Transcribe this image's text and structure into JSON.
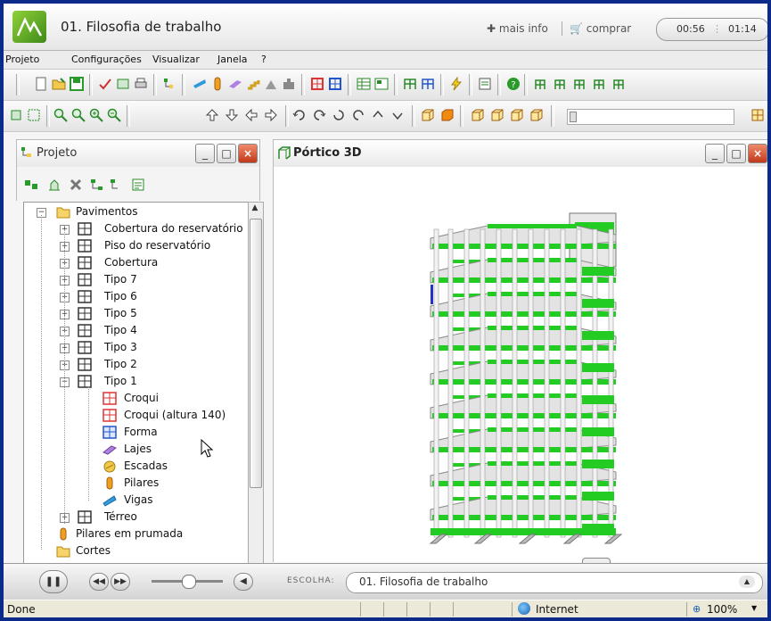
{
  "window": {
    "title": "01. Filosofia de trabalho",
    "mais_info": "mais info",
    "comprar": "comprar",
    "timer_elapsed": "00:56",
    "timer_total": "01:14"
  },
  "menu": [
    "Projeto",
    "Configurações",
    "Visualizar",
    "Janela",
    "?"
  ],
  "left_panel": {
    "title": "Projeto",
    "tree": [
      {
        "label": "Pavimentos",
        "icon": "folder-icon"
      },
      {
        "label": "Cobertura do reservatório",
        "icon": "floor-icon"
      },
      {
        "label": "Piso do reservatório",
        "icon": "floor-icon"
      },
      {
        "label": "Cobertura",
        "icon": "floor-icon"
      },
      {
        "label": "Tipo 7",
        "icon": "floor-icon"
      },
      {
        "label": "Tipo 6",
        "icon": "floor-icon"
      },
      {
        "label": "Tipo 5",
        "icon": "floor-icon"
      },
      {
        "label": "Tipo 4",
        "icon": "floor-icon"
      },
      {
        "label": "Tipo 3",
        "icon": "floor-icon"
      },
      {
        "label": "Tipo 2",
        "icon": "floor-icon"
      },
      {
        "label": "Tipo 1",
        "icon": "floor-icon"
      },
      {
        "label": "Croqui",
        "icon": "croqui-icon"
      },
      {
        "label": "Croqui (altura 140)",
        "icon": "croqui-icon"
      },
      {
        "label": "Forma",
        "icon": "forma-icon"
      },
      {
        "label": "Lajes",
        "icon": "slab-icon"
      },
      {
        "label": "Escadas",
        "icon": "stairs-icon"
      },
      {
        "label": "Pilares",
        "icon": "pillar-icon"
      },
      {
        "label": "Vigas",
        "icon": "beam-icon"
      },
      {
        "label": "Térreo",
        "icon": "floor-icon"
      },
      {
        "label": "Pilares em prumada",
        "icon": "pillar-icon"
      },
      {
        "label": "Cortes",
        "icon": "folder-icon"
      }
    ]
  },
  "right_panel": {
    "title": "Pórtico 3D"
  },
  "player": {
    "escolha_label": "ESCOLHA:",
    "selected": "01. Filosofia de trabalho"
  },
  "status_bar": {
    "left": "Done",
    "zone": "Internet",
    "zoom": "100%"
  },
  "colors": {
    "frame_background": "#0b2a8a",
    "model_green": "#22cc22",
    "accent_close": "#c0391a"
  }
}
